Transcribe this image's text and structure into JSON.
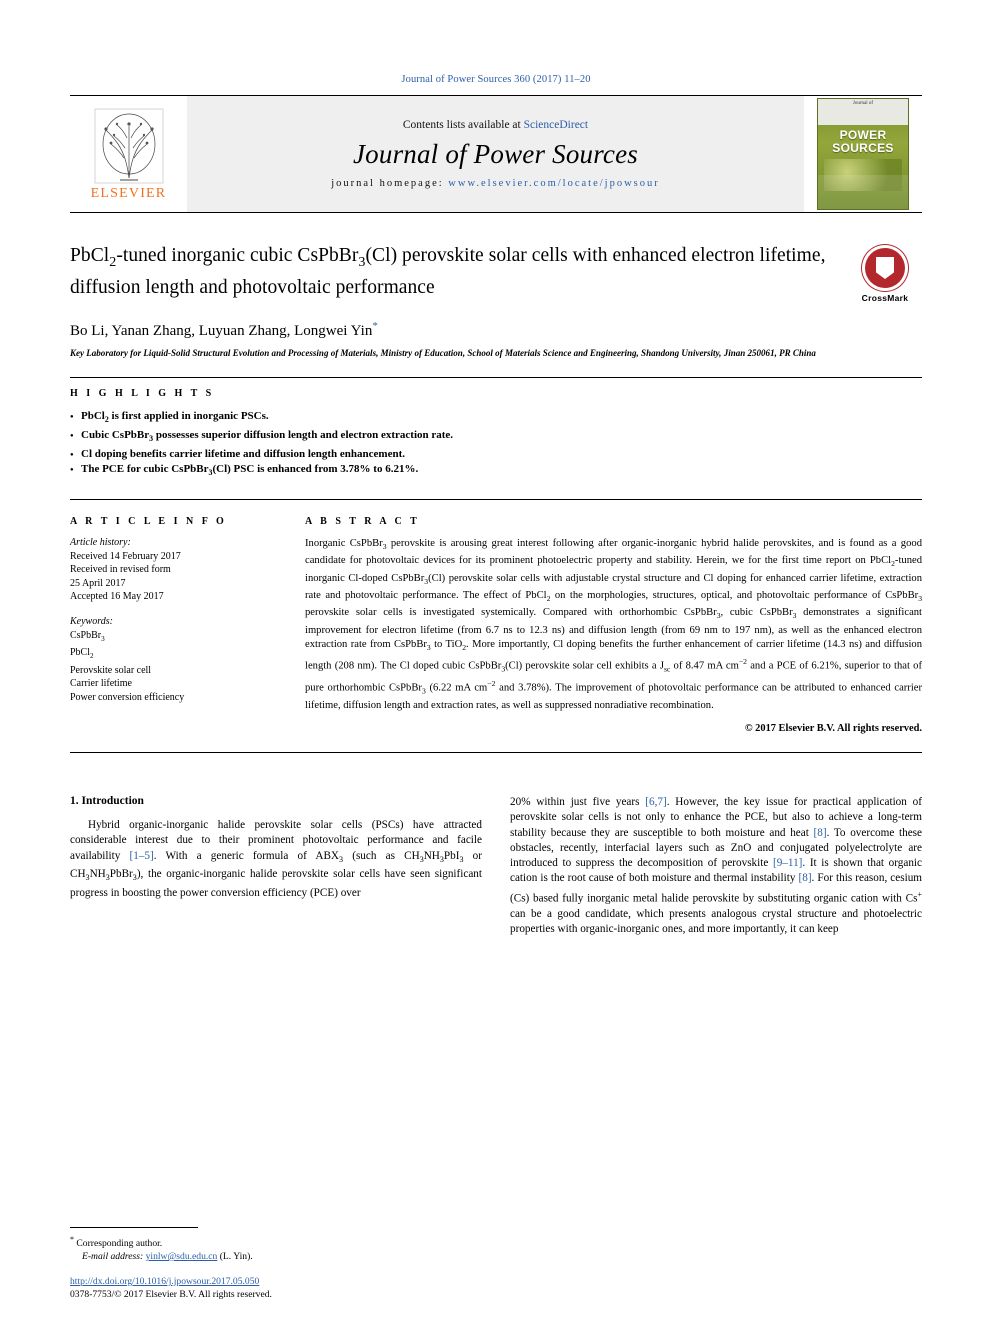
{
  "header": {
    "journal_ref": "Journal of Power Sources 360 (2017) 11–20"
  },
  "masthead": {
    "publisher": "ELSEVIER",
    "contents_prefix": "Contents lists available at ",
    "contents_link": "ScienceDirect",
    "journal_title": "Journal of Power Sources",
    "homepage_label": "journal homepage: ",
    "homepage_url": "www.elsevier.com/locate/jpowsour",
    "cover_line1": "Journal of",
    "cover_title": "POWER SOURCES"
  },
  "article": {
    "title": "PbCl2-tuned inorganic cubic CsPbBr3(Cl) perovskite solar cells with enhanced electron lifetime, diffusion length and photovoltaic performance",
    "authors": "Bo Li, Yanan Zhang, Luyuan Zhang, Longwei Yin",
    "affiliation": "Key Laboratory for Liquid-Solid Structural Evolution and Processing of Materials, Ministry of Education, School of Materials Science and Engineering, Shandong University, Jinan 250061, PR China",
    "crossmark_label": "CrossMark"
  },
  "highlights": {
    "heading": "H I G H L I G H T S",
    "items": [
      "PbCl2 is first applied in inorganic PSCs.",
      "Cubic CsPbBr3 possesses superior diffusion length and electron extraction rate.",
      "Cl doping benefits carrier lifetime and diffusion length enhancement.",
      "The PCE for cubic CsPbBr3(Cl) PSC is enhanced from 3.78% to 6.21%."
    ]
  },
  "article_info": {
    "heading": "A R T I C L E   I N F O",
    "history_label": "Article history:",
    "history": [
      "Received 14 February 2017",
      "Received in revised form",
      "25 April 2017",
      "Accepted 16 May 2017"
    ],
    "keywords_label": "Keywords:",
    "keywords": [
      "CsPbBr3",
      "PbCl2",
      "Perovskite solar cell",
      "Carrier lifetime",
      "Power conversion efficiency"
    ]
  },
  "abstract": {
    "heading": "A B S T R A C T",
    "text": "Inorganic CsPbBr3 perovskite is arousing great interest following after organic-inorganic hybrid halide perovskites, and is found as a good candidate for photovoltaic devices for its prominent photoelectric property and stability. Herein, we for the first time report on PbCl2-tuned inorganic Cl-doped CsPbBr3(Cl) perovskite solar cells with adjustable crystal structure and Cl doping for enhanced carrier lifetime, extraction rate and photovoltaic performance. The effect of PbCl2 on the morphologies, structures, optical, and photovoltaic performance of CsPbBr3 perovskite solar cells is investigated systemically. Compared with orthorhombic CsPbBr3, cubic CsPbBr3 demonstrates a significant improvement for electron lifetime (from 6.7 ns to 12.3 ns) and diffusion length (from 69 nm to 197 nm), as well as the enhanced electron extraction rate from CsPbBr3 to TiO2. More importantly, Cl doping benefits the further enhancement of carrier lifetime (14.3 ns) and diffusion length (208 nm). The Cl doped cubic CsPbBr3(Cl) perovskite solar cell exhibits a Jsc of 8.47 mA cm−2 and a PCE of 6.21%, superior to that of pure orthorhombic CsPbBr3 (6.22 mA cm−2 and 3.78%). The improvement of photovoltaic performance can be attributed to enhanced carrier lifetime, diffusion length and extraction rates, as well as suppressed nonradiative recombination.",
    "rights": "© 2017 Elsevier B.V. All rights reserved."
  },
  "body": {
    "section_title": "1.  Introduction",
    "left_paragraph": "Hybrid organic-inorganic halide perovskite solar cells (PSCs) have attracted considerable interest due to their prominent photovoltaic performance and facile availability [1–5]. With a generic formula of ABX3 (such as CH3NH3PbI3 or CH3NH3PbBr3), the organic-inorganic halide perovskite solar cells have seen significant progress in boosting the power conversion efficiency (PCE) over",
    "right_paragraph": "20% within just five years [6,7]. However, the key issue for practical application of perovskite solar cells is not only to enhance the PCE, but also to achieve a long-term stability because they are susceptible to both moisture and heat [8]. To overcome these obstacles, recently, interfacial layers such as ZnO and conjugated polyelectrolyte are introduced to suppress the decomposition of perovskite [9–11]. It is shown that organic cation is the root cause of both moisture and thermal instability [8]. For this reason, cesium (Cs) based fully inorganic metal halide perovskite by substituting organic cation with Cs+ can be a good candidate, which presents analogous crystal structure and photoelectric properties with organic-inorganic ones, and more importantly, it can keep"
  },
  "footer": {
    "corresponding_label": "Corresponding author.",
    "email_label": "E-mail address: ",
    "email": "yinlw@sdu.edu.cn",
    "email_suffix": " (L. Yin).",
    "doi": "http://dx.doi.org/10.1016/j.jpowsour.2017.05.050",
    "issn": "0378-7753/© 2017 Elsevier B.V. All rights reserved."
  },
  "colors": {
    "link": "#2b5fa8",
    "elsevier_orange": "#F37021",
    "crossmark_red": "#b3282d"
  }
}
